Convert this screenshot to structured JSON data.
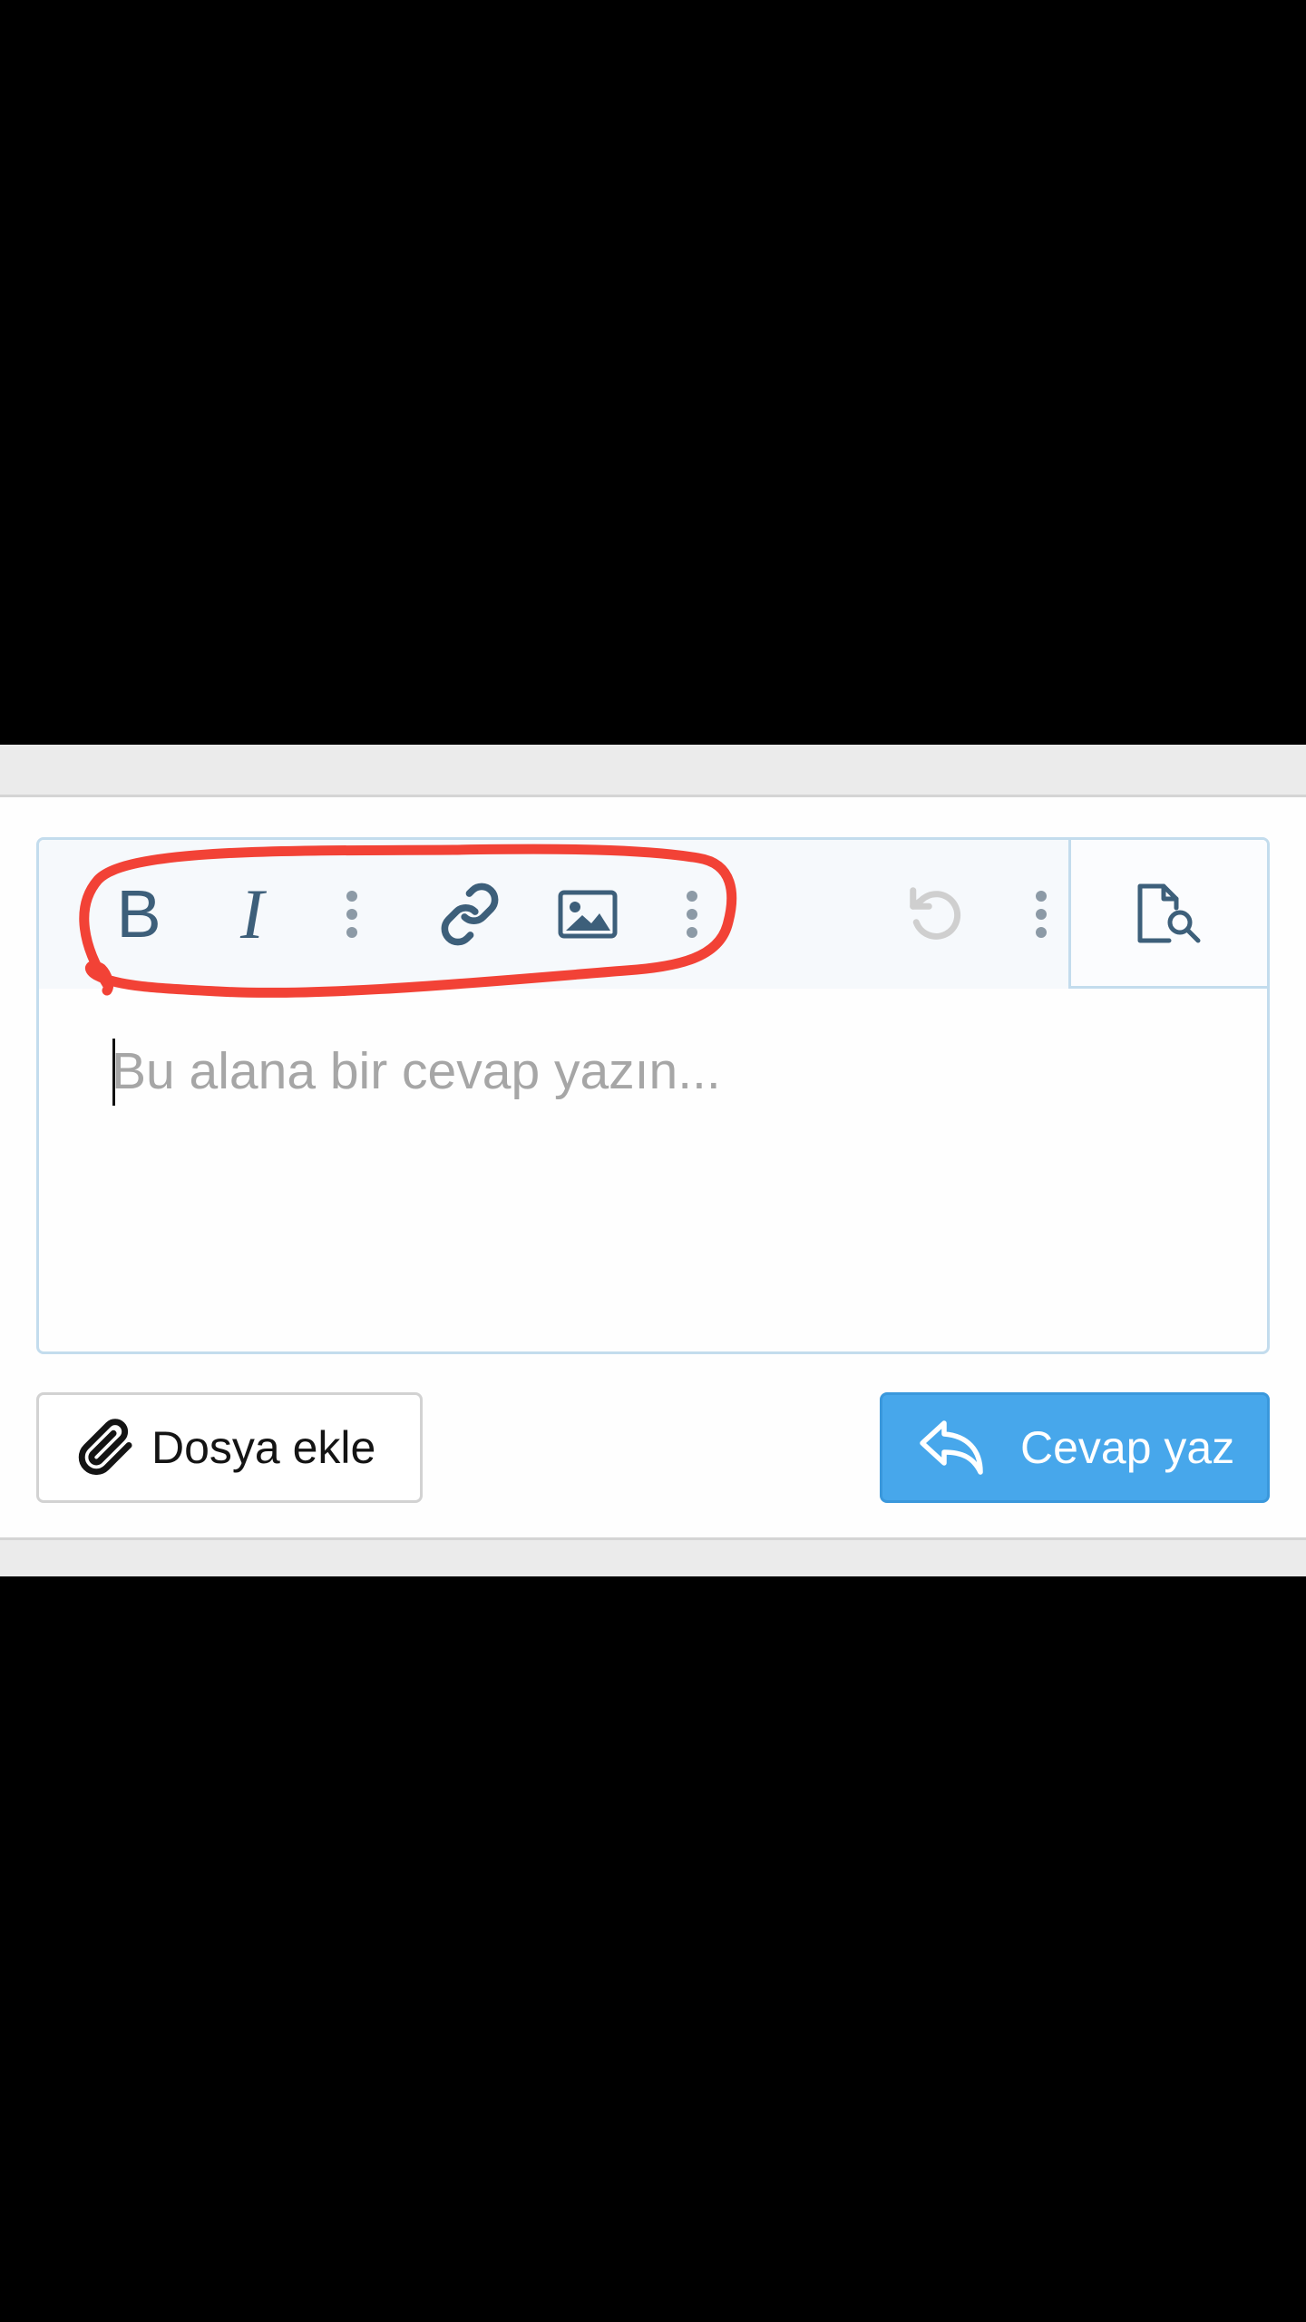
{
  "editor": {
    "placeholder": "Bu alana bir cevap yazın...",
    "toolbar": {
      "bold_label": "B",
      "italic_label": "I",
      "icons": [
        "bold-icon",
        "italic-icon",
        "more-vertical-icon",
        "link-icon",
        "image-icon",
        "more-vertical-icon",
        "undo-icon",
        "more-vertical-icon",
        "preview-icon"
      ]
    }
  },
  "actions": {
    "attach_label": "Dosya ekle",
    "reply_label": "Cevap yaz"
  },
  "colors": {
    "accent": "#47a7eb",
    "icon": "#3d5f7a",
    "annotation": "#f24236"
  }
}
